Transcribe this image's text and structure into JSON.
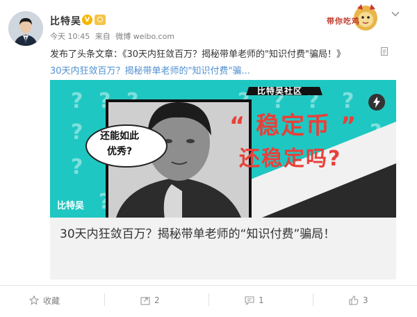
{
  "post": {
    "author": "比特吴",
    "verified_badge": "V",
    "timestamp": "今天 10:45",
    "source_prefix": "来自",
    "source": "微博 weibo.com",
    "mascot_text": "带你吃鸡",
    "text": "发布了头条文章：《30天内狂敛百万？揭秘带单老师的\"知识付费\"骗局！》",
    "link": "30天内狂敛百万？揭秘带单老师的\"知识付费\"骗...",
    "card": {
      "image_banner": "比特吴社区",
      "speech_bubble": [
        "还能如此",
        "优秀?"
      ],
      "headline_top": "“ 稳定币 ”",
      "headline_bottom": "还稳定吗?",
      "watermark": "比特吴",
      "title": "30天内狂敛百万？揭秘带单老师的“知识付费”骗局！"
    }
  },
  "actions": {
    "favorite": "收藏",
    "repost": "2",
    "comment": "1",
    "like": "3"
  },
  "colors": {
    "link": "#4f90cf",
    "card_teal": "#1fc7c2",
    "headline_red": "#e8403a",
    "badge_gold": "#f7b500"
  }
}
